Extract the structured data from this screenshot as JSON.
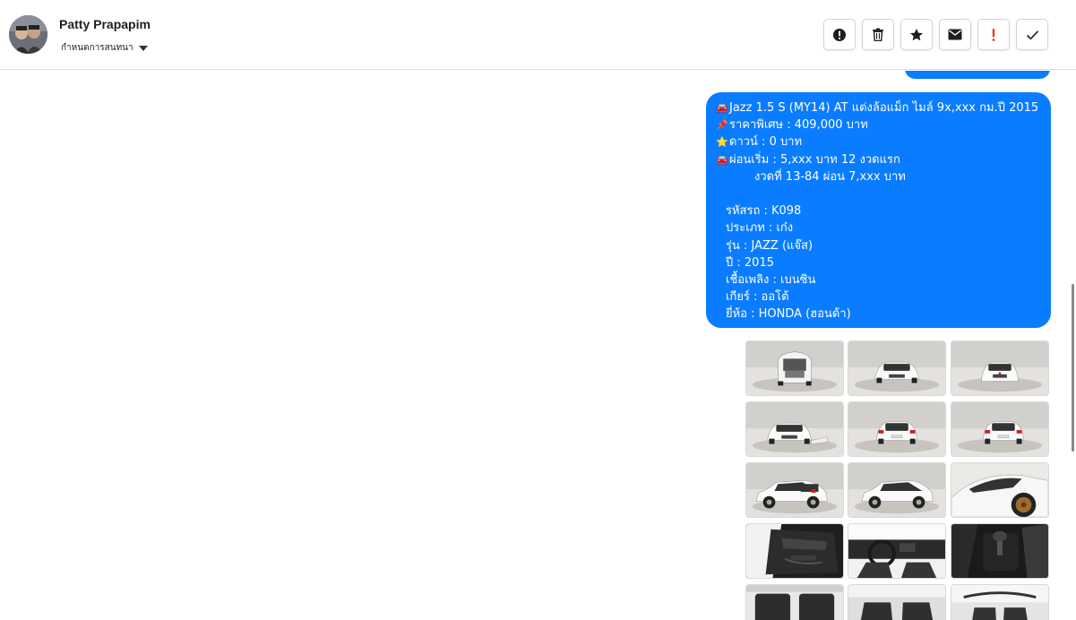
{
  "header": {
    "user_name": "Patty Prapapim",
    "conversation_menu_label": "กำหนดการสนทนา"
  },
  "toolbar": {
    "buttons": [
      {
        "name": "spam-button",
        "icon": "exclamation-circle-icon"
      },
      {
        "name": "delete-button",
        "icon": "trash-icon"
      },
      {
        "name": "star-button",
        "icon": "star-icon"
      },
      {
        "name": "mark-unread-button",
        "icon": "envelope-icon"
      },
      {
        "name": "important-button",
        "icon": "exclamation-red-icon"
      },
      {
        "name": "mark-done-button",
        "icon": "check-icon"
      }
    ],
    "important_color": "#e0401c"
  },
  "message": {
    "bubble_color": "#0a7cff",
    "lines": [
      {
        "emoji": "🚘",
        "text": "Jazz 1.5 S (MY14) AT แต่งล้อแม็ก ไมล์ 9x,xxx กม.ปี 2015"
      },
      {
        "emoji": "📌",
        "text": "ราคาพิเศษ : 409,000 บาท"
      },
      {
        "emoji": "⭐",
        "text": "ดาวน์ : 0 บาท"
      },
      {
        "emoji": "🚘",
        "text": "ผ่อนเริ่ม : 5,xxx บาท 12 งวดแรก"
      },
      {
        "emoji": "",
        "text": "งวดที่ 13-84 ผ่อน 7,xxx บาท"
      },
      {
        "emoji": "",
        "text": ""
      },
      {
        "emoji": "",
        "text": "รหัสรถ : K098"
      },
      {
        "emoji": "",
        "text": "ประเภท : เก๋ง"
      },
      {
        "emoji": "",
        "text": "รุ่น : JAZZ (แจ๊ส)"
      },
      {
        "emoji": "",
        "text": "ปี : 2015"
      },
      {
        "emoji": "",
        "text": "เชื้อเพลิง : เบนซิน"
      },
      {
        "emoji": "",
        "text": "เกียร์ : ออโต้"
      },
      {
        "emoji": "",
        "text": "ยี่ห้อ : HONDA (ฮอนด้า)"
      }
    ]
  },
  "photos": [
    "car-rear-hatch-open-photo",
    "car-front-photo",
    "car-front-straight-photo",
    "car-front-left-photo",
    "car-rear-photo",
    "car-rear-straight-photo",
    "car-rear-left-photo",
    "car-side-photo",
    "car-wheel-closeup-photo",
    "car-door-interior-photo",
    "car-dashboard-photo",
    "car-gear-shift-photo",
    "car-rear-seat-photo",
    "car-front-seat-photo",
    "car-cabin-photo"
  ]
}
